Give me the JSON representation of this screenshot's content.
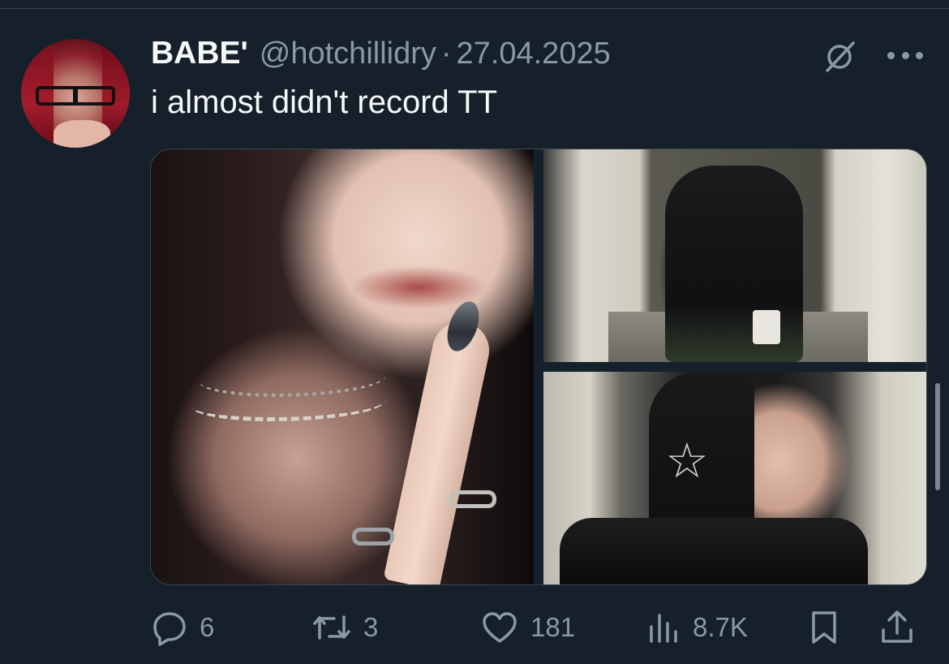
{
  "tweet": {
    "display_name": "BABE'",
    "handle": "@hotchillidry",
    "separator": "·",
    "date": "27.04.2025",
    "text": "i almost didn't record TT"
  },
  "media": {
    "photo_count": 3,
    "photos": [
      "close-up-face-photo",
      "subway-full-body-photo",
      "subway-profile-photo"
    ]
  },
  "actions": {
    "reply_count": "6",
    "retweet_count": "3",
    "like_count": "181",
    "views_count": "8.7K"
  },
  "icons": {
    "grok": "grok-icon",
    "more": "more-icon",
    "reply": "reply-icon",
    "retweet": "retweet-icon",
    "like": "heart-icon",
    "views": "views-icon",
    "bookmark": "bookmark-icon",
    "share": "share-icon"
  },
  "colors": {
    "background": "#15202b",
    "text_primary": "#f7f9f9",
    "text_secondary": "#8b98a5",
    "border": "#38444d"
  }
}
